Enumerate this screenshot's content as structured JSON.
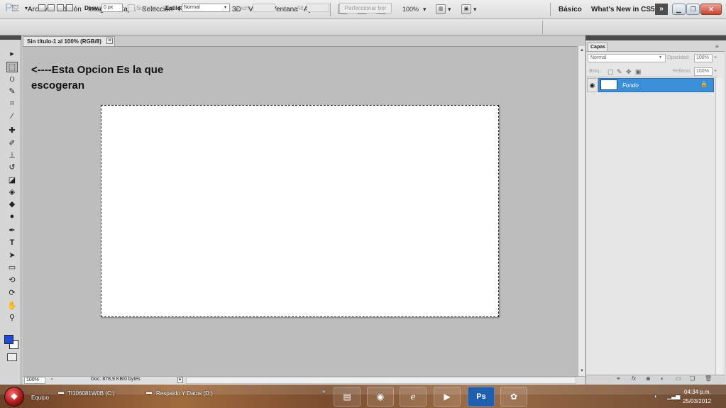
{
  "app": {
    "logo": "Ps",
    "menu": [
      "Archivo",
      "Edición",
      "Imagen",
      "Capa",
      "Selección",
      "Filtro",
      "Análisis",
      "3D",
      "Vista",
      "Ventana",
      "Ayuda"
    ],
    "bridge_label": "Br",
    "minibridge_label": "Mb",
    "zoom_level": "100%",
    "workspace": "Básico",
    "whats_new": "What's New in CS5",
    "expand_label": "»"
  },
  "options_bar": {
    "feather_label": "Desv.:",
    "feather_value": "0 px",
    "antialias_label": "Suavizar",
    "style_label": "Estilo:",
    "style_value": "Normal",
    "width_label": "Anch.:",
    "height_label": "Alt.:",
    "refine_edge": "Perfeccionar bor"
  },
  "document": {
    "tab_title": "Sin título-1 al 100% (RGB/8)",
    "annotation": "<----Esta Opcion Es la que escogeran",
    "zoom": "100%",
    "doc_info": "Doc: 878,9 KB/0 bytes"
  },
  "layers_panel": {
    "tab": "Capas",
    "blend_mode": "Normal",
    "opacity_label": "Opacidad:",
    "opacity_value": "100%",
    "lock_label": "Bloq.:",
    "fill_label": "Relleno:",
    "fill_value": "100%",
    "layers": [
      {
        "name": "Fondo",
        "selected": true,
        "visible": true,
        "locked": true
      }
    ]
  },
  "taskbar": {
    "equipo": "Equipo",
    "drive_c": "TI106081W0B (C:)",
    "drive_d": "Respaldo Y Datos (D:)",
    "time": "04:34 p.m.",
    "date": "25/03/2012"
  },
  "colors": {
    "foreground": "#1f4bd6",
    "background": "#ffffff",
    "selection": "#3b8ed8"
  }
}
